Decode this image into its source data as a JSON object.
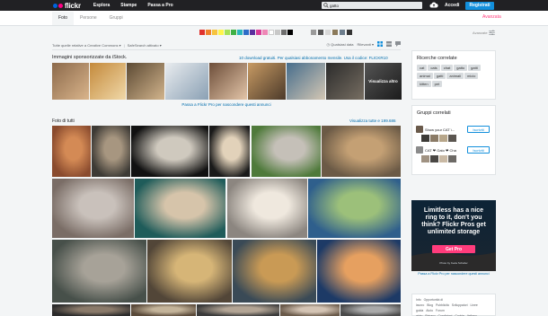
{
  "header": {
    "logo_text": "flickr",
    "nav": [
      "Esplora",
      "Stampe",
      "Passa a Pro"
    ],
    "search_value": "gatto",
    "login": "Accedi",
    "signup": "Registrati",
    "colors": {
      "bar": "#212124",
      "blue": "#0063dc",
      "pink": "#ff0084",
      "accent": "#128fdc"
    }
  },
  "subnav": {
    "tabs": [
      "Foto",
      "Persone",
      "Gruppi"
    ],
    "active_tab": "Foto",
    "advanced": "Avanzata"
  },
  "filters": {
    "swatch_colors": [
      "#e0322d",
      "#f0812a",
      "#f6c33e",
      "#fff54a",
      "#a6e155",
      "#3fb145",
      "#2ab6bc",
      "#2c6cc7",
      "#5a2e9d",
      "#d93b96",
      "#ee87b6",
      "#ffffff",
      "#c8c8c8",
      "#6e6e6e",
      "#000000"
    ],
    "texture_colors": [
      "#9a9a9a",
      "#555",
      "#d8d8d8",
      "#8b7a5a",
      "#6c7d8c",
      "#333"
    ],
    "advanced_label": "Avanzate"
  },
  "sort": {
    "license": "Tutte quelle relative a Creative Commons",
    "safesearch": "SafeSearch attivato",
    "date": "Qualsiasi data",
    "relevance": "Rilevanti"
  },
  "sponsored": {
    "title": "Immagini sponsorizzate da iStock.",
    "offer": "10 download gratuiti. Per qualsiasi abbonamento mensile. Usa il codice: FLICKR10",
    "see_more": "Visualizza altro",
    "promo": "Passa a Flickr Pro per nascondere questi annunci"
  },
  "photos": {
    "title": "Foto di tutti",
    "see_all": "Visualizza tutte e 199.686"
  },
  "sidebar": {
    "related_title": "Ricerche correlate",
    "tags": [
      "cat",
      "cats",
      "chat",
      "gatto",
      "gatti",
      "animal",
      "gatti",
      "animali",
      "micio",
      "kitten",
      "pet"
    ],
    "groups_title": "Gruppi correlati",
    "groups": [
      {
        "name": "Show your CAT \\...",
        "join": "Iscriviti"
      },
      {
        "name": "CAT ❤ Gato ❤ Chat...",
        "join": "Iscriviti"
      }
    ],
    "ad": {
      "text": "Limitless has a nice ring to it, don't you think? Flickr Pros get unlimited storage",
      "button": "Get Pro",
      "credit": "Photo by Keda Scheller",
      "promo": "Passa a Flickr Pro per nascondere questi annunci"
    },
    "footer_links": [
      "Info",
      "Opportunità di lavoro",
      "Blog",
      "Pubblicità",
      "Sviluppatori",
      "Linee guida",
      "Aiuto",
      "Forum aiuto",
      "Privacy",
      "Condizioni",
      "Cookie",
      "Italiano"
    ]
  }
}
